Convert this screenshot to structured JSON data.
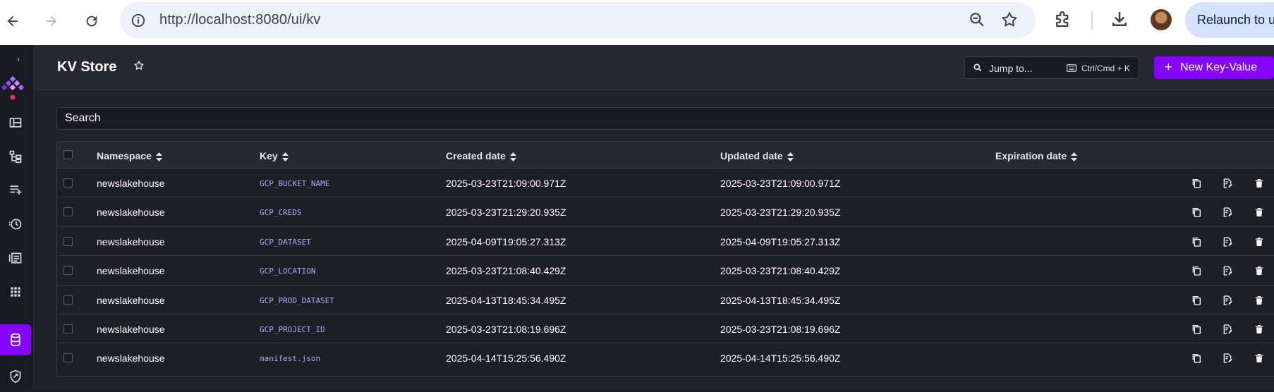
{
  "browser": {
    "url": "http://localhost:8080/ui/kv",
    "relaunch_label": "Relaunch to u"
  },
  "sidebar": {
    "toggle_glyph": "›",
    "items": [
      {
        "icon": "dashboard-icon"
      },
      {
        "icon": "flows-icon"
      },
      {
        "icon": "templates-icon"
      },
      {
        "icon": "executions-icon"
      },
      {
        "icon": "logs-icon"
      },
      {
        "icon": "namespaces-icon"
      },
      {
        "icon": "kv-store-icon",
        "active": true
      },
      {
        "icon": "administration-icon"
      }
    ]
  },
  "header": {
    "title": "KV Store",
    "jump_placeholder": "Jump to...",
    "shortcut": "Ctrl/Cmd + K",
    "new_button": "New Key-Value",
    "new_button_plus": "+"
  },
  "search": {
    "placeholder": "Search"
  },
  "table": {
    "columns": [
      "Namespace",
      "Key",
      "Created date",
      "Updated date",
      "Expiration date"
    ],
    "rows": [
      {
        "namespace": "newslakehouse",
        "key": "GCP_BUCKET_NAME",
        "created": "2025-03-23T21:09:00.971Z",
        "updated": "2025-03-23T21:09:00.971Z",
        "expiration": ""
      },
      {
        "namespace": "newslakehouse",
        "key": "GCP_CREDS",
        "created": "2025-03-23T21:29:20.935Z",
        "updated": "2025-03-23T21:29:20.935Z",
        "expiration": ""
      },
      {
        "namespace": "newslakehouse",
        "key": "GCP_DATASET",
        "created": "2025-04-09T19:05:27.313Z",
        "updated": "2025-04-09T19:05:27.313Z",
        "expiration": ""
      },
      {
        "namespace": "newslakehouse",
        "key": "GCP_LOCATION",
        "created": "2025-03-23T21:08:40.429Z",
        "updated": "2025-03-23T21:08:40.429Z",
        "expiration": ""
      },
      {
        "namespace": "newslakehouse",
        "key": "GCP_PROD_DATASET",
        "created": "2025-04-13T18:45:34.495Z",
        "updated": "2025-04-13T18:45:34.495Z",
        "expiration": ""
      },
      {
        "namespace": "newslakehouse",
        "key": "GCP_PROJECT_ID",
        "created": "2025-03-23T21:08:19.696Z",
        "updated": "2025-03-23T21:08:19.696Z",
        "expiration": ""
      },
      {
        "namespace": "newslakehouse",
        "key": "manifest.json",
        "created": "2025-04-14T15:25:56.490Z",
        "updated": "2025-04-14T15:25:56.490Z",
        "expiration": ""
      }
    ]
  },
  "colors": {
    "accent": "#8405ff",
    "key_text": "#b0a8ff"
  }
}
